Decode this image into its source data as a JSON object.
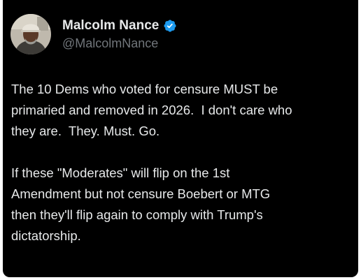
{
  "tweet": {
    "author": {
      "display_name": "Malcolm Nance",
      "handle": "@MalcolmNance",
      "verified": true,
      "avatar_icon": "profile-photo",
      "verified_icon": "verified-badge-icon",
      "verified_color": "#1d9bf0"
    },
    "body_lines": [
      "The 10 Dems who voted for censure MUST be",
      "primaried and removed in 2026.  I don't care who",
      "they are.  They. Must. Go.",
      "",
      "If these \"Moderates\" will flip on the 1st",
      "Amendment but not censure Boebert or MTG",
      "then they'll flip again to comply with Trump's",
      "dictatorship."
    ]
  },
  "theme": {
    "background": "#000000",
    "text_primary": "#e7e9ea",
    "text_secondary": "#71767b"
  }
}
